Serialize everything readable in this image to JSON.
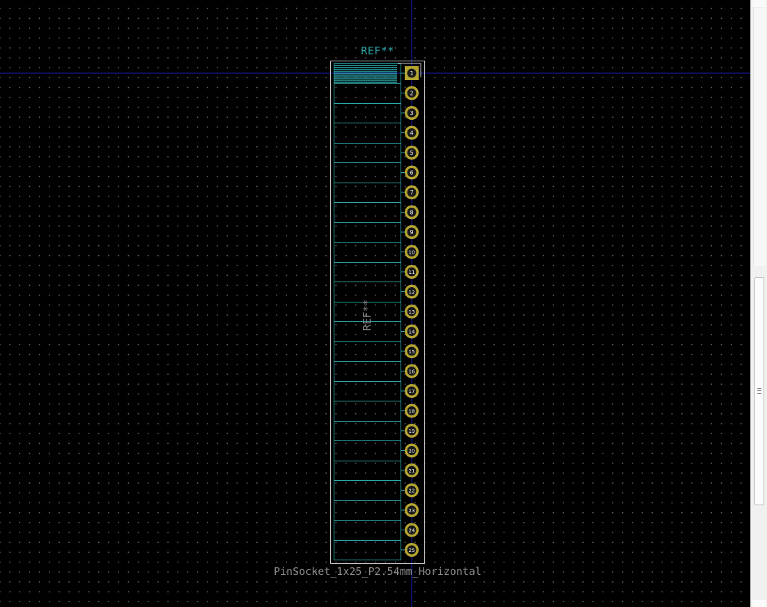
{
  "app": {
    "kind": "footprint-editor-canvas"
  },
  "footprint": {
    "reference_top": "REF**",
    "reference_center": "REF**",
    "name": "PinSocket_1x25_P2.54mm_Horizontal",
    "pin_count": 25,
    "pins": [
      "1",
      "2",
      "3",
      "4",
      "5",
      "6",
      "7",
      "8",
      "9",
      "10",
      "11",
      "12",
      "13",
      "14",
      "15",
      "16",
      "17",
      "18",
      "19",
      "20",
      "21",
      "22",
      "23",
      "24",
      "25"
    ]
  },
  "colors": {
    "background": "#000000",
    "grid_dot": "#6a6a6a",
    "crosshair": "#1e1ebe",
    "silkscreen": "#2ea7aa",
    "fab_text": "#8a8a8a",
    "courtyard": "#c8c8c8",
    "pad": "#b5a531",
    "pad_hole": "#1a1a1a",
    "pad_label": "#ffffff"
  }
}
